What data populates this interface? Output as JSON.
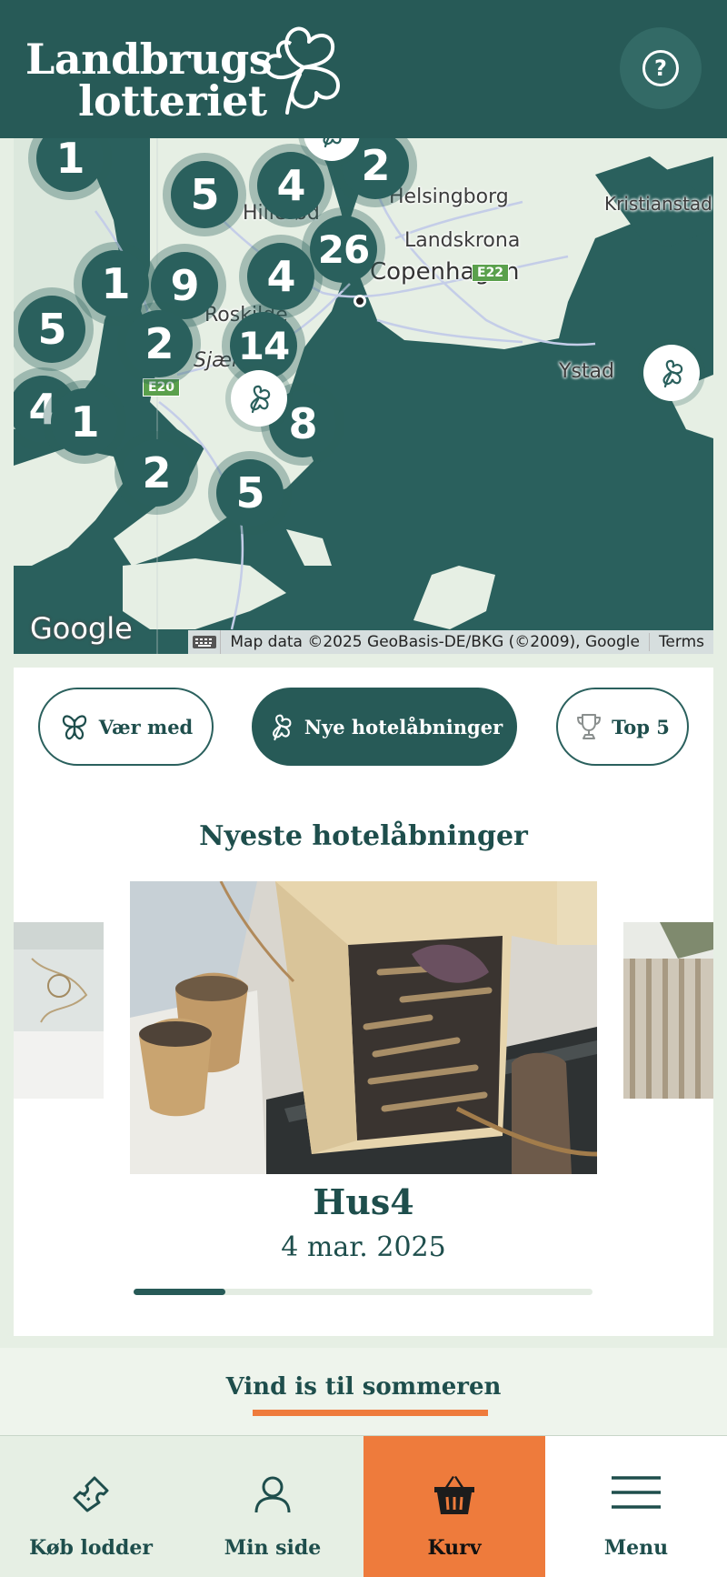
{
  "header": {
    "logo_line1": "Landbrugs",
    "logo_line2": "lotteriet",
    "help_label": "?"
  },
  "map": {
    "clusters": [
      "1",
      "5",
      "4",
      "2",
      "26",
      "4",
      "1",
      "9",
      "5",
      "2",
      "14",
      "4",
      "1",
      "8",
      "2",
      "5"
    ],
    "cities": {
      "helsingborg": "Helsingborg",
      "kristianstad": "Kristianstad",
      "landskrona": "Landskrona",
      "hillerod": "Hillerød",
      "copenhagen": "Copenhagen",
      "roskilde": "Roskilde",
      "sjaelland": "Sjæll",
      "ystad": "Ystad"
    },
    "roads": {
      "e22": "E22",
      "e20": "E20"
    },
    "google_logo": "Google",
    "attribution": "Map data ©2025 GeoBasis-DE/BKG (©2009), Google",
    "terms": "Terms",
    "water_color": "#2a605d",
    "land_color": "#e6efe4"
  },
  "tabs": [
    {
      "label": "Vær med",
      "icon": "butterfly-icon",
      "active": false
    },
    {
      "label": "Nye hotelåbninger",
      "icon": "clover-icon",
      "active": true
    },
    {
      "label": "Top 5",
      "icon": "trophy-icon",
      "active": false
    }
  ],
  "carousel": {
    "section_title": "Nyeste hotelåbninger",
    "slide_title": "Hus4",
    "slide_date": "4 mar. 2025",
    "progress": 0.2
  },
  "promo": {
    "link_label": "Vind is til sommeren"
  },
  "bottom_nav": {
    "buy": "Køb lodder",
    "profile": "Min side",
    "cart": "Kurv",
    "menu": "Menu"
  },
  "colors": {
    "brand_dark": "#275a57",
    "accent_orange": "#ee7b3c",
    "background_light": "#e6efe4"
  }
}
